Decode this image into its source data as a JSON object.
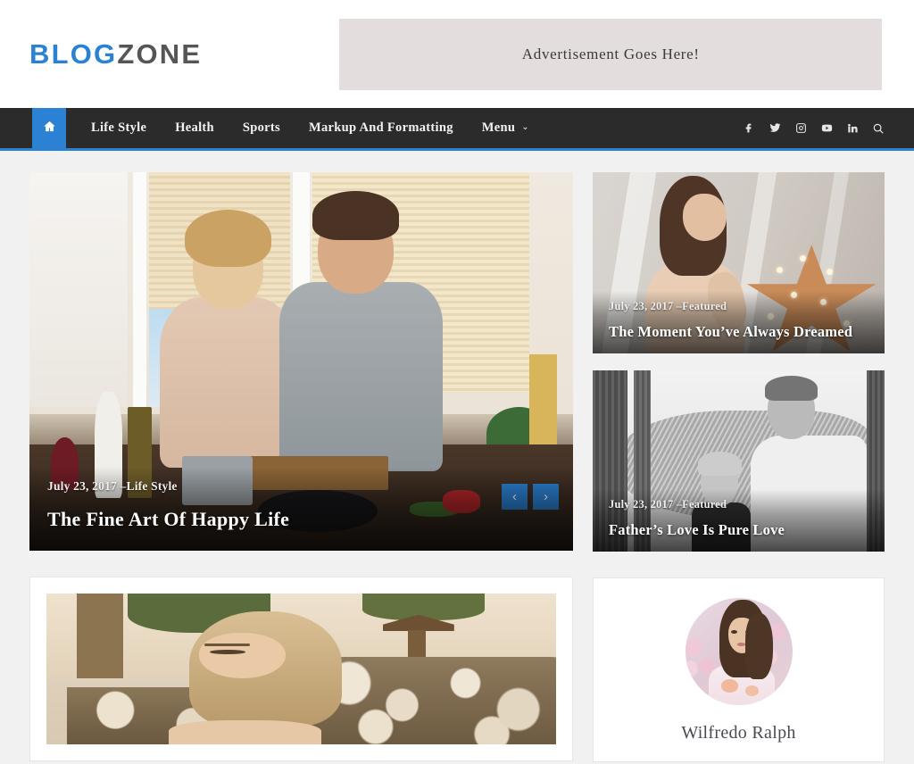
{
  "header": {
    "logo_primary": "BLOG",
    "logo_secondary": "ZONE",
    "ad_text": "Advertisement Goes Here!"
  },
  "nav": {
    "home_icon": "home-icon",
    "items": [
      {
        "label": "Life Style",
        "has_dropdown": false
      },
      {
        "label": "Health",
        "has_dropdown": false
      },
      {
        "label": "Sports",
        "has_dropdown": false
      },
      {
        "label": "Markup And Formatting",
        "has_dropdown": false
      },
      {
        "label": "Menu",
        "has_dropdown": true
      }
    ],
    "dropdown_glyph": "⌄",
    "social": [
      {
        "name": "facebook-icon"
      },
      {
        "name": "twitter-icon"
      },
      {
        "name": "instagram-icon"
      },
      {
        "name": "youtube-icon"
      },
      {
        "name": "linkedin-icon"
      },
      {
        "name": "search-icon"
      }
    ]
  },
  "hero": {
    "date": "July 23, 2017",
    "category": "–Life Style",
    "title": "The Fine Art Of Happy Life",
    "prev_glyph": "‹",
    "next_glyph": "›"
  },
  "featured": [
    {
      "date": "July 23, 2017",
      "category": "–Featured",
      "title": "The Moment You’ve Always Dreamed"
    },
    {
      "date": "July 23, 2017",
      "category": "–Featured",
      "title": "Father’s Love Is Pure Love"
    }
  ],
  "author_widget": {
    "name": "Wilfredo Ralph"
  },
  "colors": {
    "accent_blue": "#2b82d4",
    "nav_dark": "#2b2b2b",
    "page_bg": "#f1f1f1",
    "ad_bg": "#e3dddd",
    "logo_gray": "#555555"
  }
}
